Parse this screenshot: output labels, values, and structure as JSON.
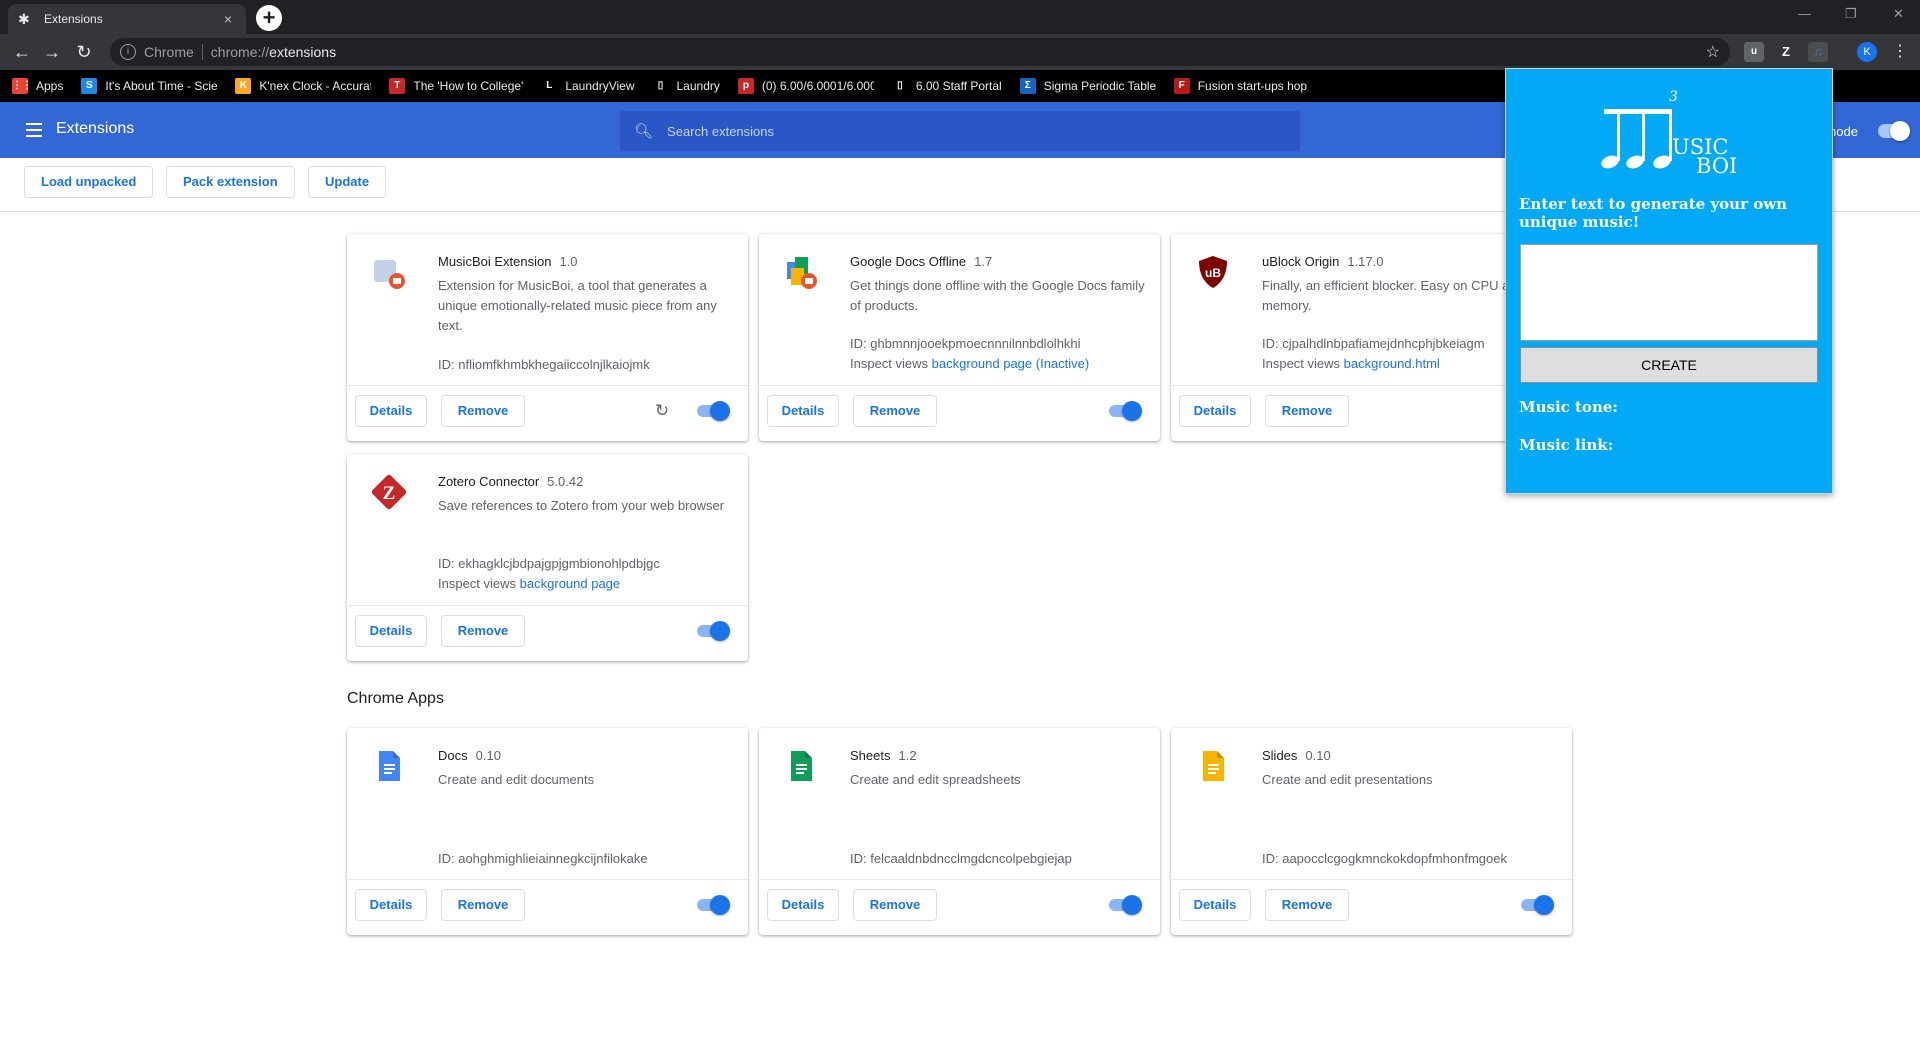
{
  "window": {
    "tab_title": "Extensions",
    "tab_close": "×",
    "new_tab": "+",
    "controls": [
      "—",
      "❐",
      "✕"
    ]
  },
  "toolbar": {
    "chip": "Chrome",
    "url_scheme": "chrome://",
    "url_host": "extensions",
    "avatar_letter": "K"
  },
  "bookmarks": [
    {
      "label": "Apps",
      "icon": "apps-grid-icon",
      "color": "#ea4335",
      "glyph": "⋮⋮"
    },
    {
      "label": "It's About Time - Scie",
      "icon": "s-logo-icon",
      "color": "#1e88e5",
      "glyph": "S"
    },
    {
      "label": "K'nex Clock - Accurat",
      "icon": "knex-icon",
      "color": "#f9a825",
      "glyph": "K"
    },
    {
      "label": "The 'How to College'",
      "icon": "news-icon",
      "color": "#c62828",
      "glyph": "T"
    },
    {
      "label": "LaundryView",
      "icon": "laundryview-icon",
      "color": "#000000",
      "glyph": "L"
    },
    {
      "label": "Laundry",
      "icon": "document-icon",
      "color": "#000000",
      "glyph": "▯"
    },
    {
      "label": "(0) 6.00/6.0001/6.000",
      "icon": "piazza-icon",
      "color": "#c62828",
      "glyph": "p"
    },
    {
      "label": "6.00 Staff Portal",
      "icon": "document-icon",
      "color": "#000000",
      "glyph": "▯"
    },
    {
      "label": "Sigma Periodic Table",
      "icon": "sigma-icon",
      "color": "#1565c0",
      "glyph": "Σ"
    },
    {
      "label": "Fusion start-ups hop",
      "icon": "fusion-icon",
      "color": "#b71c1c",
      "glyph": "F"
    }
  ],
  "header": {
    "title": "Extensions",
    "search_placeholder": "Search extensions",
    "dev_mode_label": "Developer mode",
    "dev_mode_visible": "node",
    "dev_mode_on": true
  },
  "dev_toolbar": {
    "load_unpacked": "Load unpacked",
    "pack_extension": "Pack extension",
    "update": "Update"
  },
  "extensions": [
    {
      "name": "MusicBoi Extension",
      "version": "1.0",
      "description": "Extension for MusicBoi, a tool that generates a unique emotionally-related music piece from any text.",
      "id": "ID: nfliomfkhmbkhegaiiccolnjlkaiojmk",
      "inspect": "",
      "inspect_link": "",
      "enabled": true,
      "reload": true,
      "icon": "puzzle-piece-icon"
    },
    {
      "name": "Google Docs Offline",
      "version": "1.7",
      "description": "Get things done offline with the Google Docs family of products.",
      "id": "ID: ghbmnnjooekpmoecnnnilnnbdlolhkhi",
      "inspect": "Inspect views",
      "inspect_link": "background page (Inactive)",
      "enabled": true,
      "reload": false,
      "icon": "docs-offline-icon"
    },
    {
      "name": "uBlock Origin",
      "version": "1.17.0",
      "description": "Finally, an efficient blocker. Easy on CPU and memory.",
      "id": "ID: cjpalhdlnbpafiamejdnhcphjbkeiagm",
      "inspect": "Inspect views",
      "inspect_link": "background.html",
      "enabled": true,
      "reload": false,
      "icon": "ublock-shield-icon"
    },
    {
      "name": "Zotero Connector",
      "version": "5.0.42",
      "description": "Save references to Zotero from your web browser",
      "id": "ID: ekhagklcjbdpajgpjgmbionohlpdbjgc",
      "inspect": "Inspect views",
      "inspect_link": "background page",
      "enabled": true,
      "reload": false,
      "icon": "zotero-icon"
    }
  ],
  "apps_section_title": "Chrome Apps",
  "apps": [
    {
      "name": "Docs",
      "version": "0.10",
      "description": "Create and edit documents",
      "id": "ID: aohghmighlieiainnegkcijnfilokake",
      "enabled": true,
      "icon": "docs-icon",
      "color": "#4285f4"
    },
    {
      "name": "Sheets",
      "version": "1.2",
      "description": "Create and edit spreadsheets",
      "id": "ID: felcaaldnbdncclmgdcncolpebgiejap",
      "enabled": true,
      "icon": "sheets-icon",
      "color": "#0f9d58"
    },
    {
      "name": "Slides",
      "version": "0.10",
      "description": "Create and edit presentations",
      "id": "ID: aapocclcgogkmnckokdopfmhonfmgoek",
      "enabled": true,
      "icon": "slides-icon",
      "color": "#f4b400"
    }
  ],
  "buttons": {
    "details": "Details",
    "remove": "Remove"
  },
  "popup": {
    "logo_text_1": "USIC",
    "logo_text_2": "BOI",
    "logo_number": "3",
    "prompt": "Enter text to generate your own unique music!",
    "input_value": "",
    "create_label": "CREATE",
    "tone_label": "Music tone:",
    "link_label": "Music link:",
    "background": "#03a9f4"
  }
}
